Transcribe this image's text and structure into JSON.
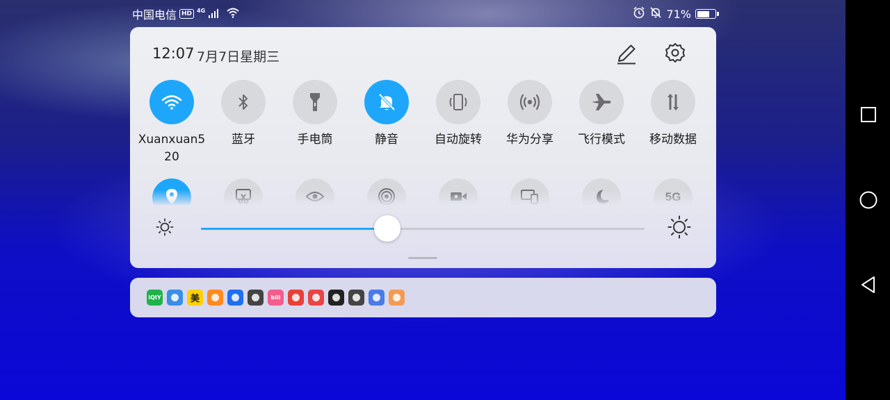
{
  "status_bar": {
    "carrier": "中国电信",
    "hd_badge": "HD",
    "network_type": "4G",
    "battery_percent": "71%",
    "battery_level": 0.71,
    "icons": [
      "signal-icon",
      "wifi-icon",
      "alarm-icon",
      "mute-icon",
      "battery-icon"
    ]
  },
  "panel": {
    "time": "12:07",
    "date": "7月7日星期三",
    "edit_icon": "pencil-icon",
    "settings_icon": "gear-icon"
  },
  "toggles": [
    {
      "label": "Xuanxuan520",
      "label_lines": [
        "Xuanxuan5",
        "20"
      ],
      "icon": "wifi-icon",
      "active": true
    },
    {
      "label": "蓝牙",
      "icon": "bluetooth-icon",
      "active": false
    },
    {
      "label": "手电筒",
      "icon": "flashlight-icon",
      "active": false
    },
    {
      "label": "静音",
      "icon": "bell-off-icon",
      "active": true
    },
    {
      "label": "自动旋转",
      "icon": "auto-rotate-icon",
      "active": false
    },
    {
      "label": "华为分享",
      "icon": "huawei-share-icon",
      "active": false
    },
    {
      "label": "飞行模式",
      "icon": "airplane-icon",
      "active": false
    },
    {
      "label": "移动数据",
      "icon": "mobile-data-icon",
      "active": false
    }
  ],
  "toggles_row2": [
    {
      "icon": "location-icon",
      "active": true
    },
    {
      "icon": "screenshot-icon",
      "active": false
    },
    {
      "icon": "eye-comfort-icon",
      "active": false
    },
    {
      "icon": "hotspot-icon",
      "active": false
    },
    {
      "icon": "screen-record-icon",
      "active": false
    },
    {
      "icon": "multi-screen-icon",
      "active": false
    },
    {
      "icon": "dark-mode-icon",
      "active": false
    },
    {
      "icon": "5g-icon",
      "text": "5G",
      "active": false
    }
  ],
  "brightness": {
    "level": 0.42,
    "low_icon": "brightness-low-icon",
    "high_icon": "brightness-high-icon"
  },
  "notification_apps": [
    {
      "name": "iqiyi-app-icon",
      "text": "iQIY",
      "color": "#21b24b"
    },
    {
      "name": "browser-app-icon",
      "text": "",
      "color": "#3a8ee6"
    },
    {
      "name": "meituan-app-icon",
      "text": "美",
      "color": "#ffd000"
    },
    {
      "name": "video-app-icon",
      "text": "",
      "color": "#ff8a1f"
    },
    {
      "name": "tips-app-icon",
      "text": "",
      "color": "#1f6ff0"
    },
    {
      "name": "cloud-app-icon",
      "text": "",
      "color": "#444444"
    },
    {
      "name": "bilibili-app-icon",
      "text": "bili",
      "color": "#f25d8e"
    },
    {
      "name": "huawei-app-icon",
      "text": "",
      "color": "#e8403a"
    },
    {
      "name": "reader-app-icon",
      "text": "",
      "color": "#e84545"
    },
    {
      "name": "qq-app-icon",
      "text": "",
      "color": "#222222"
    },
    {
      "name": "wechat-app-icon",
      "text": "",
      "color": "#444444"
    },
    {
      "name": "music-app-icon",
      "text": "",
      "color": "#4a7be8"
    },
    {
      "name": "messages-app-icon",
      "text": "",
      "color": "#f29b54"
    }
  ],
  "nav": [
    "recent-apps-icon",
    "home-icon",
    "back-icon"
  ]
}
